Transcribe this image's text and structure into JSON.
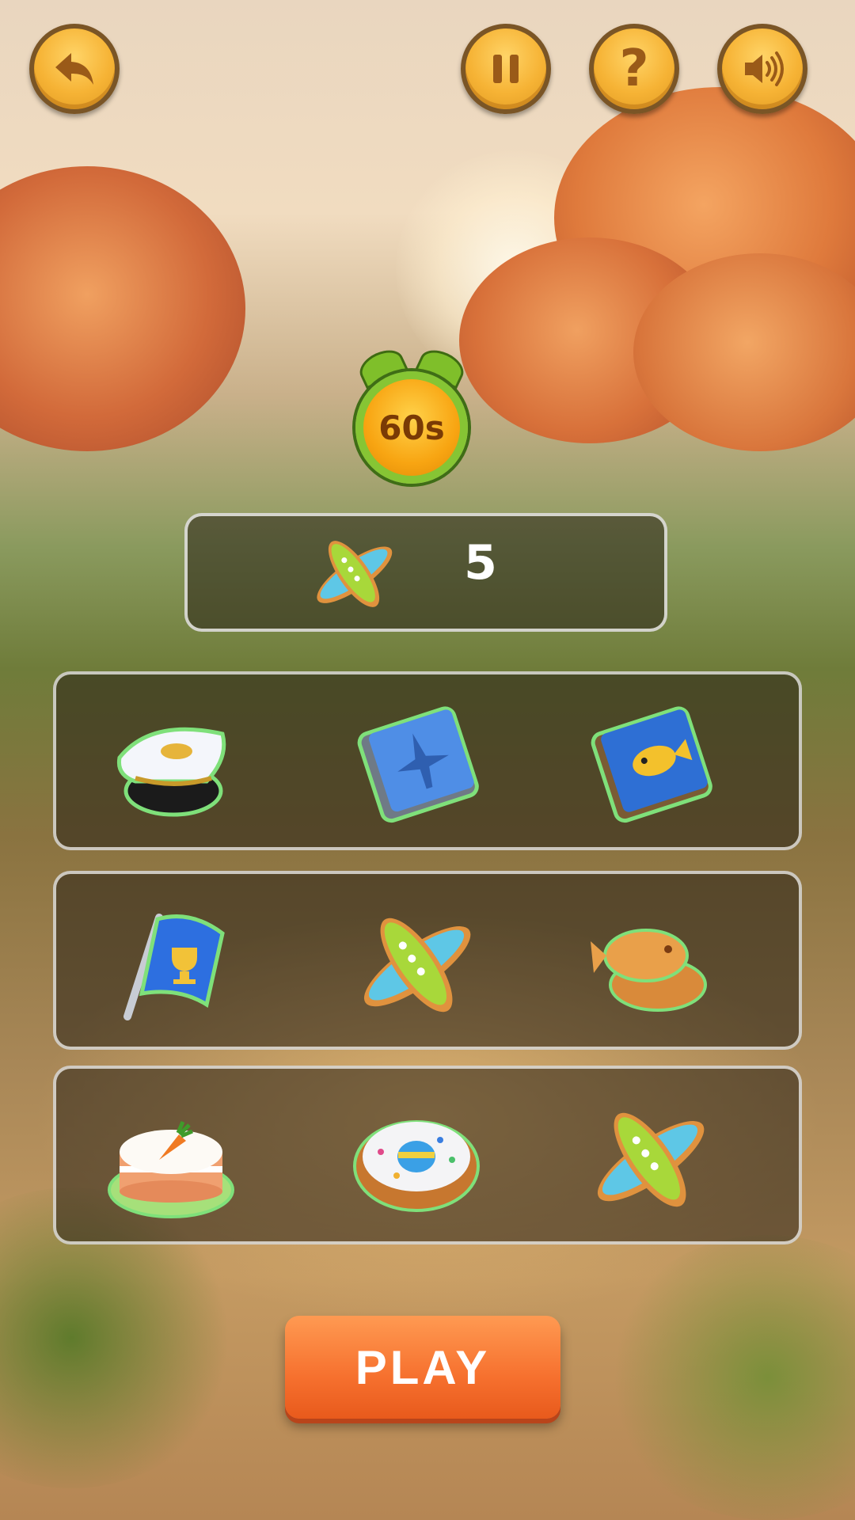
{
  "top_bar": {
    "back_icon": "back-arrow-icon",
    "pause_icon": "pause-icon",
    "help_label": "?",
    "sound_icon": "speaker-icon"
  },
  "timer": {
    "label": "60s"
  },
  "target": {
    "item_icon": "airplane-cookie-icon",
    "count": "5"
  },
  "grid": {
    "rows": [
      [
        "captain-hat-icon",
        "airplane-book-icon",
        "fish-book-icon"
      ],
      [
        "trophy-flag-icon",
        "airplane-cookie-icon",
        "fish-cookie-icon"
      ],
      [
        "carrot-cake-icon",
        "easter-wreath-icon",
        "airplane-cookie-icon"
      ]
    ]
  },
  "play_button": {
    "label": "PLAY"
  },
  "colors": {
    "button_gold": "#f6b335",
    "button_border": "#7a5526",
    "timer_green": "#86c534",
    "timer_orange": "#f8a512",
    "play_orange": "#f6702e",
    "panel_bg": "#28201680"
  }
}
